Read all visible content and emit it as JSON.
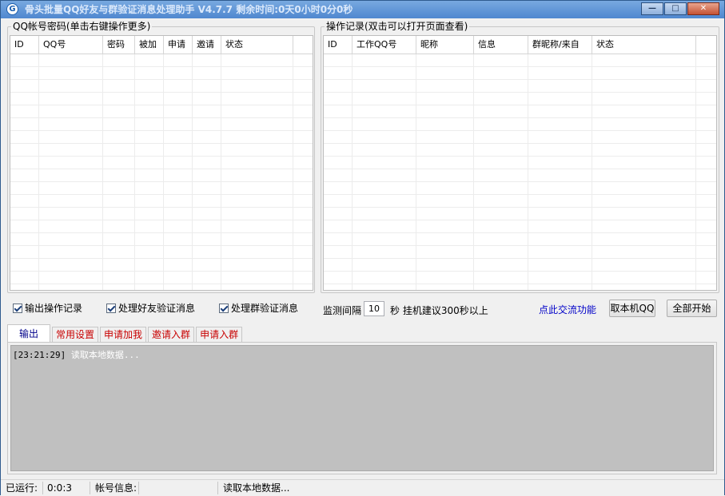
{
  "window": {
    "title": "骨头批量QQ好友与群验证消息处理助手 V4.7.7 剩余时间:0天0小时0分0秒",
    "icon_letter": "G",
    "controls": {
      "minimize": "—",
      "maximize": "□",
      "close": "✕"
    }
  },
  "accounts_panel": {
    "title": "QQ帐号密码(单击右键操作更多)",
    "columns": [
      "ID",
      "QQ号",
      "密码",
      "被加",
      "申请",
      "邀请",
      "状态"
    ]
  },
  "records_panel": {
    "title": "操作记录(双击可以打开页面查看)",
    "columns": [
      "ID",
      "工作QQ号",
      "昵称",
      "信息",
      "群昵称/来自",
      "状态"
    ]
  },
  "options": {
    "output_log": "输出操作记录",
    "handle_friend": "处理好友验证消息",
    "handle_group": "处理群验证消息",
    "interval_label": "监测间隔",
    "interval_value": "10",
    "interval_unit_hint": "秒  挂机建议300秒以上",
    "link_exchange": "点此交流功能",
    "get_local_qq": "取本机QQ",
    "start_all": "全部开始"
  },
  "tabs": {
    "items": [
      "输出",
      "常用设置",
      "申请加我",
      "邀请入群",
      "申请入群"
    ],
    "active_index": 0
  },
  "log": {
    "timestamp": "[23:21:29]",
    "message": " 读取本地数据..."
  },
  "status": {
    "run_label": "已运行:",
    "run_value": "0:0:3",
    "account_label": "帐号信息:",
    "account_value": "",
    "message": "读取本地数据..."
  },
  "colors": {
    "titlebar": "#5b93d6",
    "tab_text_inactive": "#c80000",
    "tab_text_active": "#00008a",
    "link": "#0000c8",
    "log_background": "#c0c0c0"
  }
}
